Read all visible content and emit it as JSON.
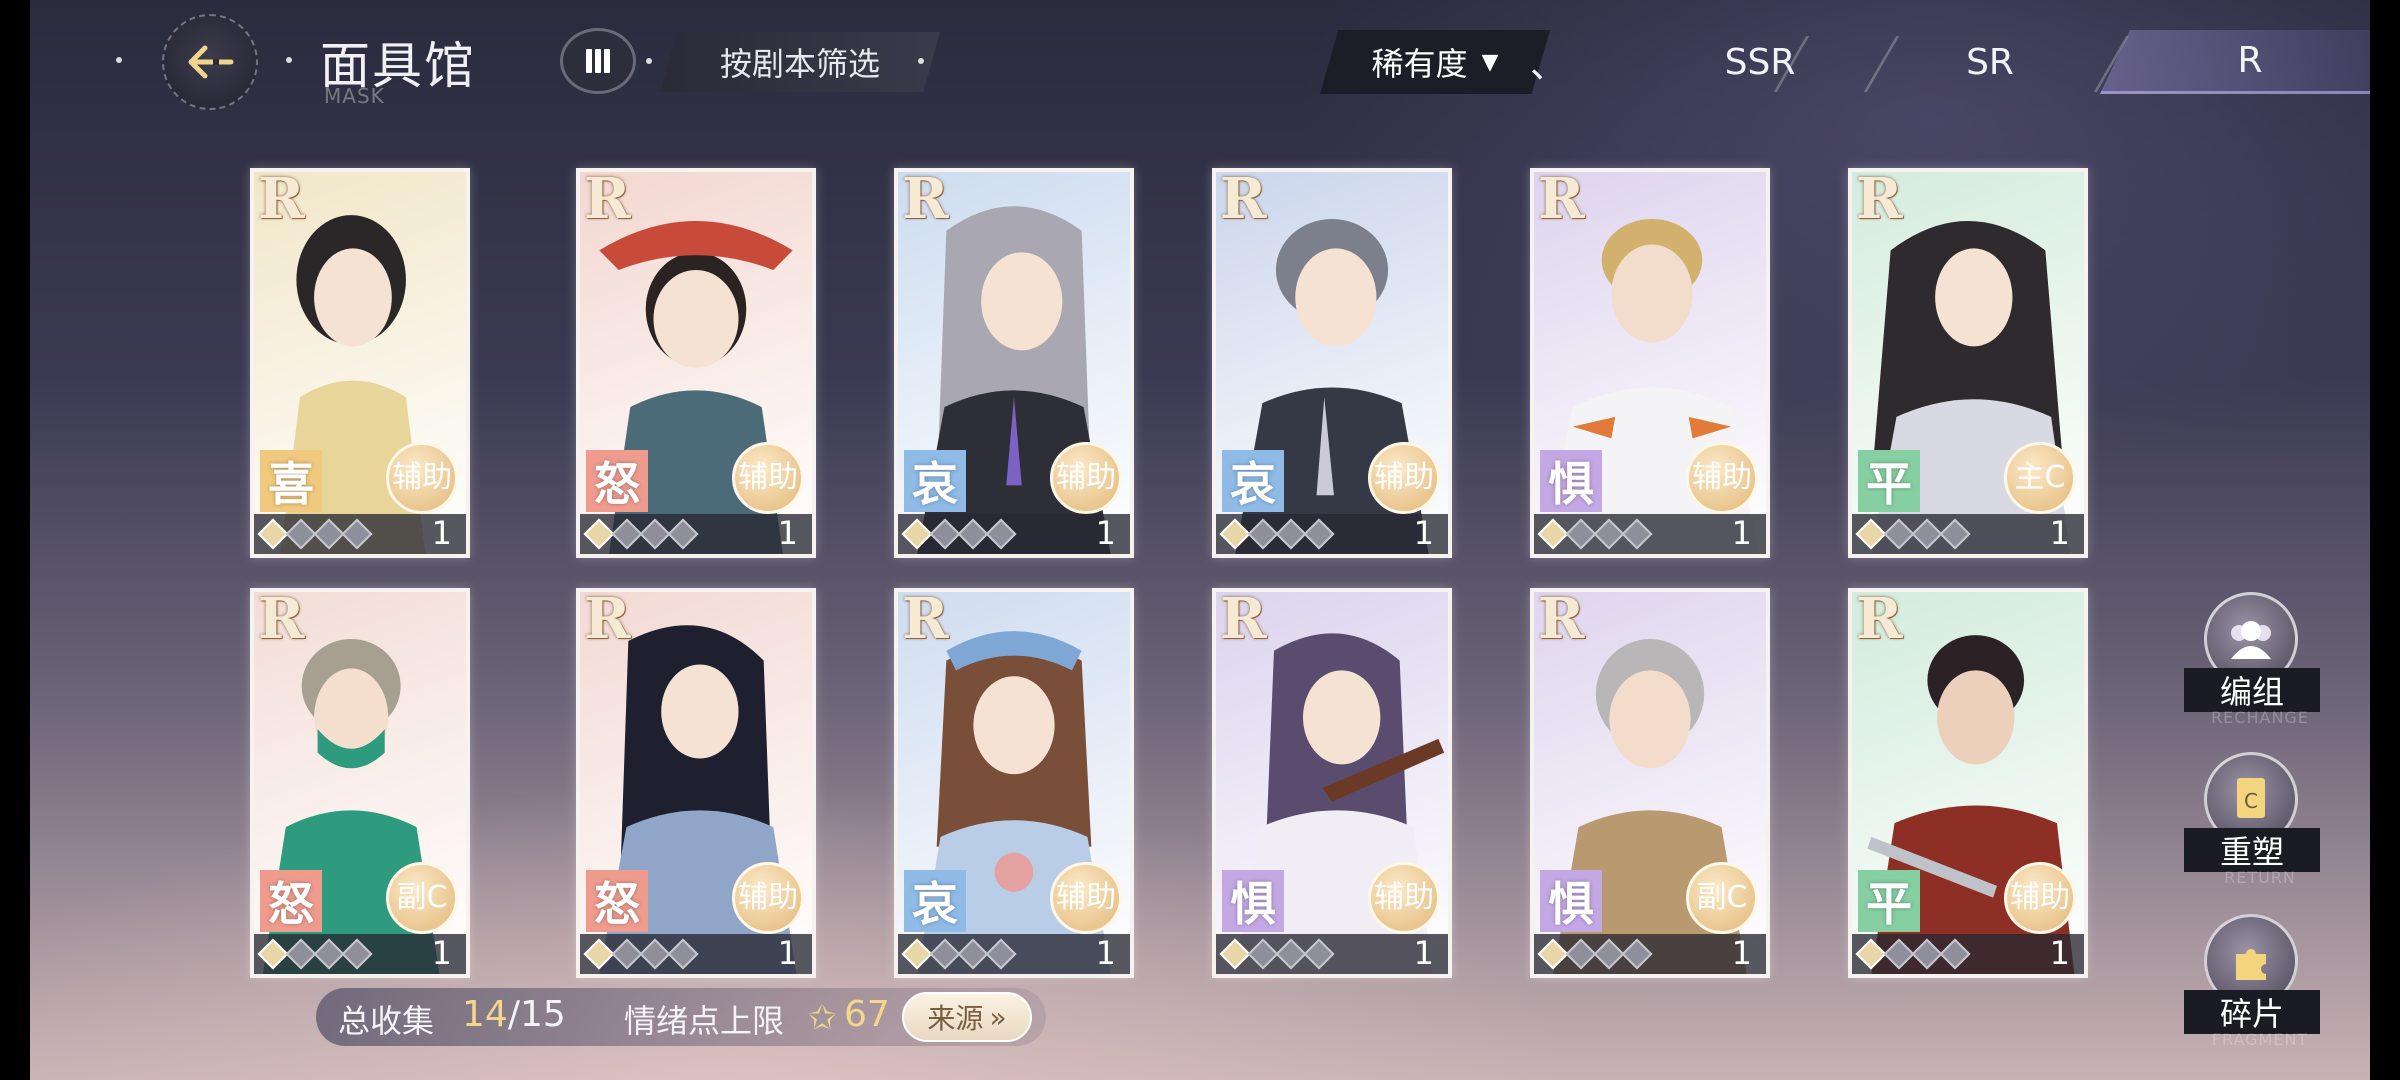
{
  "header": {
    "title": "面具馆",
    "subtitle": "MASK",
    "filter_label": "按剧本筛选"
  },
  "tabs": {
    "sort_label": "稀有度",
    "sort_caret": "▼",
    "items": [
      {
        "label": "、",
        "active": false
      },
      {
        "label": "SSR",
        "active": false
      },
      {
        "label": "SR",
        "active": false
      },
      {
        "label": "R",
        "active": true
      }
    ]
  },
  "cards": [
    {
      "rarity": "R",
      "emotion": "喜",
      "emotion_color": "#f0c97e",
      "role": "辅助",
      "count": "1",
      "bg": "#f1e6c8",
      "accent": "#e7d59a"
    },
    {
      "rarity": "R",
      "emotion": "怒",
      "emotion_color": "#ef9c8f",
      "role": "辅助",
      "count": "1",
      "bg": "#f3d7d0",
      "accent": "#c84a3a"
    },
    {
      "rarity": "R",
      "emotion": "哀",
      "emotion_color": "#8fbbe6",
      "role": "辅助",
      "count": "1",
      "bg": "#cddcf0",
      "accent": "#8a8d9a"
    },
    {
      "rarity": "R",
      "emotion": "哀",
      "emotion_color": "#8fbbe6",
      "role": "辅助",
      "count": "1",
      "bg": "#cbd6ec",
      "accent": "#5b5f70"
    },
    {
      "rarity": "R",
      "emotion": "惧",
      "emotion_color": "#c4a8e4",
      "role": "辅助",
      "count": "1",
      "bg": "#ded4ee",
      "accent": "#d2b06e"
    },
    {
      "rarity": "R",
      "emotion": "平",
      "emotion_color": "#86cfa2",
      "role": "主C",
      "count": "1",
      "bg": "#d4ecdd",
      "accent": "#2f2a2d"
    },
    {
      "rarity": "R",
      "emotion": "怒",
      "emotion_color": "#ef9c8f",
      "role": "副C",
      "count": "1",
      "bg": "#f3ddd6",
      "accent": "#2e9b7e"
    },
    {
      "rarity": "R",
      "emotion": "怒",
      "emotion_color": "#ef9c8f",
      "role": "辅助",
      "count": "1",
      "bg": "#f3d9d4",
      "accent": "#1e2030"
    },
    {
      "rarity": "R",
      "emotion": "哀",
      "emotion_color": "#8fbbe6",
      "role": "辅助",
      "count": "1",
      "bg": "#cfdcf0",
      "accent": "#7a4f3a"
    },
    {
      "rarity": "R",
      "emotion": "惧",
      "emotion_color": "#c4a8e4",
      "role": "辅助",
      "count": "1",
      "bg": "#dcd3ee",
      "accent": "#5a4c6e"
    },
    {
      "rarity": "R",
      "emotion": "惧",
      "emotion_color": "#c4a8e4",
      "role": "副C",
      "count": "1",
      "bg": "#dfd5ee",
      "accent": "#b99a70"
    },
    {
      "rarity": "R",
      "emotion": "平",
      "emotion_color": "#86cfa2",
      "role": "辅助",
      "count": "1",
      "bg": "#d2ecdc",
      "accent": "#8d2f25"
    }
  ],
  "collection": {
    "label": "总收集",
    "current": "14",
    "total": "/15",
    "emotion_label": "情绪点上限",
    "emotion_value": "67",
    "source_label": "来源",
    "source_arrow": "»"
  },
  "side": {
    "group_label": "编组",
    "group_ghost": "RECHANGE",
    "reshape_label": "重塑",
    "reshape_ghost": "RETURN",
    "fragment_label": "碎片",
    "fragment_ghost": "FRAGMENT"
  }
}
